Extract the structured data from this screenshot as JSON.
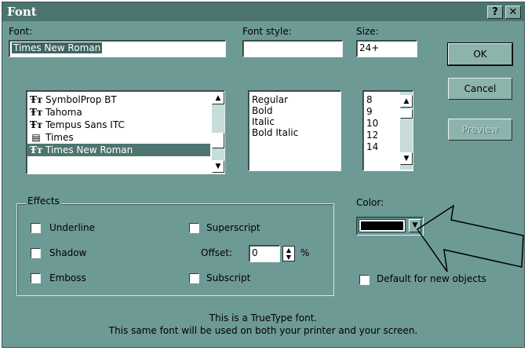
{
  "window": {
    "title": "Font",
    "help_button": "?",
    "close_button": "✕"
  },
  "font": {
    "label": "Font:",
    "value": "Times New Roman",
    "items": [
      {
        "icon": "truetype-icon",
        "glyph": "Ŧт",
        "label": "SymbolProp BT"
      },
      {
        "icon": "truetype-icon",
        "glyph": "Ŧт",
        "label": "Tahoma"
      },
      {
        "icon": "truetype-icon",
        "glyph": "Ŧт",
        "label": "Tempus Sans ITC"
      },
      {
        "icon": "printer-font-icon",
        "glyph": "▤",
        "label": "Times"
      },
      {
        "icon": "truetype-icon",
        "glyph": "Ŧт",
        "label": "Times New Roman"
      }
    ]
  },
  "font_style": {
    "label": "Font style:",
    "value": "",
    "items": [
      "Regular",
      "Bold",
      "Italic",
      "Bold Italic"
    ]
  },
  "size": {
    "label": "Size:",
    "value": "24+",
    "items": [
      "8",
      "9",
      "10",
      "12",
      "14"
    ]
  },
  "buttons": {
    "ok": "OK",
    "cancel": "Cancel",
    "preview": "Preview"
  },
  "effects": {
    "label": "Effects",
    "underline": "Underline",
    "shadow": "Shadow",
    "emboss": "Emboss",
    "superscript": "Superscript",
    "offset_label": "Offset:",
    "offset_value": "0",
    "offset_unit": "%",
    "subscript": "Subscript"
  },
  "color": {
    "label": "Color:",
    "value": "#000000",
    "default_label": "Default for new objects"
  },
  "info": {
    "line1": "This is a TrueType font.",
    "line2": "This same font will be used on both your printer and your screen."
  },
  "colors": {
    "background": "#6d9a94",
    "titlebar": "#4c7570",
    "selection": "#4c7570"
  }
}
